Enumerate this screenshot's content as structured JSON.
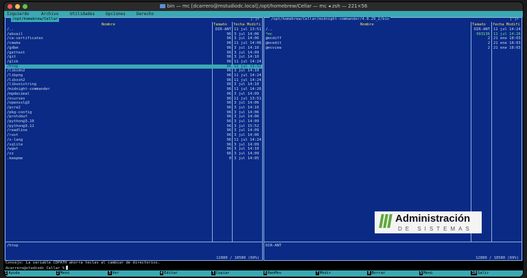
{
  "window": {
    "title": "bin — mc [dcarrero@mstudiodc.local]:/opt/homebrew/Cellar — mc ◂ zsh — 221×56"
  },
  "menu": [
    "Izquierdo",
    "Archivo",
    "Utilidades",
    "Opciones",
    "Derecho"
  ],
  "left_panel": {
    "path": "/opt/homebrew/Cellar",
    "corner": "[^]>",
    "headers": {
      "name": "Nombre",
      "size": "Tamaño",
      "date": "fecha Modifi"
    },
    "rows": [
      {
        "name": "/..",
        "size": "DIR-ANT",
        "date": "11 jul 13:51"
      },
      {
        "name": "/abseil",
        "size": "96",
        "date": "3 jul 14:06"
      },
      {
        "name": "/ca-certificates",
        "size": "96",
        "date": "3 jul 14:06"
      },
      {
        "name": "/cmake",
        "size": "96",
        "date": "11 jul 14:06"
      },
      {
        "name": "/gdbm",
        "size": "96",
        "date": "3 jul 14:10"
      },
      {
        "name": "/gettext",
        "size": "96",
        "date": "3 jul 14:09"
      },
      {
        "name": "/git",
        "size": "96",
        "date": "3 jul 14:10"
      },
      {
        "name": "/glib",
        "size": "96",
        "date": "11 jul 14:24"
      },
      {
        "name": "/htop",
        "size": "96",
        "date": "11 jul 13:52",
        "selected": true
      },
      {
        "name": "/libidn2",
        "size": "96",
        "date": "3 jul 14:10"
      },
      {
        "name": "/libpng",
        "size": "96",
        "date": "11 jul 14:24"
      },
      {
        "name": "/libssh2",
        "size": "96",
        "date": "11 jul 14:24"
      },
      {
        "name": "/libunistring",
        "size": "96",
        "date": "3 jul 14:10"
      },
      {
        "name": "/midnight-commander",
        "size": "96",
        "date": "11 jul 14:26"
      },
      {
        "name": "/mpdecimal",
        "size": "96",
        "date": "3 jul 14:09"
      },
      {
        "name": "/ncurses",
        "size": "96",
        "date": "11 jul 13:51"
      },
      {
        "name": "/openssl@3",
        "size": "96",
        "date": "3 jul 14:06"
      },
      {
        "name": "/pcre2",
        "size": "96",
        "date": "3 jul 14:10"
      },
      {
        "name": "/pkg-config",
        "size": "96",
        "date": "3 jul 14:06"
      },
      {
        "name": "/protobuf",
        "size": "96",
        "date": "3 jul 14:06"
      },
      {
        "name": "/python@3.10",
        "size": "96",
        "date": "3 jul 14:09"
      },
      {
        "name": "/python@3.11",
        "size": "96",
        "date": "3 jul 15:52"
      },
      {
        "name": "/readline",
        "size": "96",
        "date": "3 jul 14:09"
      },
      {
        "name": "/rust",
        "size": "96",
        "date": "3 jul 14:06"
      },
      {
        "name": "/s-lang",
        "size": "96",
        "date": "11 jul 14:24"
      },
      {
        "name": "/sqlite",
        "size": "96",
        "date": "3 jul 14:09"
      },
      {
        "name": "/wget",
        "size": "96",
        "date": "3 jul 14:10"
      },
      {
        "name": "/xz",
        "size": "96",
        "date": "3 jul 14:09"
      },
      {
        "name": ".keepme",
        "size": "0",
        "date": "3 jul 14:05"
      }
    ],
    "status": "/htop",
    "usage": "12880 / 18580 (69%)"
  },
  "right_panel": {
    "path": "/opt/homebrew/Cellar/midnight-commander/4.8.29_2/bin",
    "corner": "[^]>",
    "headers": {
      "name": "Nombre",
      "size": "Tamaño",
      "date": "fecha Modifi"
    },
    "rows": [
      {
        "name": "/..",
        "size": "DIR-ANT",
        "date": "11 jul 14:24"
      },
      {
        "name": "*mc",
        "size": "993136",
        "date": "11 jul 14:26",
        "exec": true
      },
      {
        "name": "@mcdiff",
        "size": "2",
        "date": "21 ene 18:03"
      },
      {
        "name": "@mcedit",
        "size": "2",
        "date": "21 ene 18:03"
      },
      {
        "name": "@mcview",
        "size": "2",
        "date": "21 ene 18:03"
      }
    ],
    "status": "DIR-ANT",
    "usage": "12880 / 18580 (69%)"
  },
  "hint": "Consejo: La variable CDPATH ahorra teclas al cambiar de directorios.",
  "prompt": "dcarrero@studiodc Cellar %",
  "fkeys": [
    {
      "num": "1",
      "label": "Ayuda"
    },
    {
      "num": "2",
      "label": "Menú"
    },
    {
      "num": "3",
      "label": "Ver"
    },
    {
      "num": "4",
      "label": "Editar"
    },
    {
      "num": "5",
      "label": "Copiar"
    },
    {
      "num": "6",
      "label": "RenMov"
    },
    {
      "num": "7",
      "label": "Mkdir"
    },
    {
      "num": "8",
      "label": "Borrar"
    },
    {
      "num": "9",
      "label": "Menú"
    },
    {
      "num": "10",
      "label": "Salir"
    }
  ],
  "watermark": {
    "line1": "Administración",
    "line2": "DE SISTEMAS",
    "bar_color": "#5ea83b"
  },
  "colors": {
    "background": "#0a2a86",
    "highlight": "#3aa9b3",
    "header": "#f4e34c",
    "exec": "#7ee07e"
  }
}
